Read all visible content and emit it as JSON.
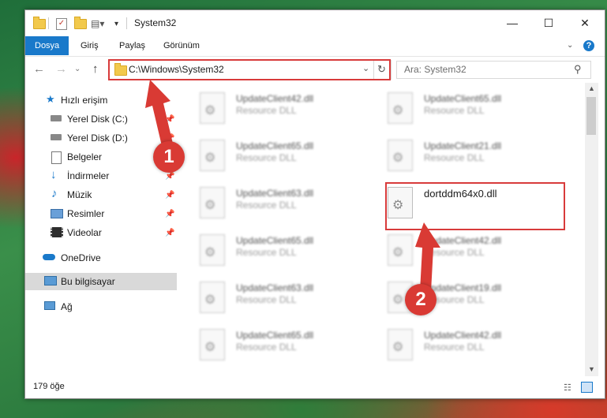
{
  "window": {
    "title": "System32",
    "controls": {
      "minimize": "—",
      "maximize": "☐",
      "close": "✕"
    }
  },
  "ribbon": {
    "tabs": [
      "Dosya",
      "Giriş",
      "Paylaş",
      "Görünüm"
    ],
    "active_tab": "Dosya",
    "help": "?"
  },
  "address": {
    "path": "C:\\Windows\\System32",
    "search_placeholder": "Ara: System32"
  },
  "nav": {
    "items": [
      {
        "label": "Hızlı erişim",
        "icon": "star-icon",
        "pinned": false
      },
      {
        "label": "Yerel Disk (C:)",
        "icon": "drive-icon",
        "pinned": true
      },
      {
        "label": "Yerel Disk (D:)",
        "icon": "drive-icon",
        "pinned": true
      },
      {
        "label": "Belgeler",
        "icon": "documents-icon",
        "pinned": true
      },
      {
        "label": "İndirmeler",
        "icon": "download-icon",
        "pinned": true
      },
      {
        "label": "Müzik",
        "icon": "music-icon",
        "pinned": true
      },
      {
        "label": "Resimler",
        "icon": "pictures-icon",
        "pinned": true
      },
      {
        "label": "Videolar",
        "icon": "videos-icon",
        "pinned": true
      },
      {
        "label": "OneDrive",
        "icon": "cloud-icon",
        "pinned": false
      },
      {
        "label": "Bu bilgisayar",
        "icon": "computer-icon",
        "pinned": false,
        "selected": true
      },
      {
        "label": "Ağ",
        "icon": "network-icon",
        "pinned": false
      }
    ]
  },
  "files": {
    "left": [
      {
        "name": "UpdateClient42.dll",
        "type": "Resource DLL"
      },
      {
        "name": "UpdateClient65.dll",
        "type": "Resource DLL"
      },
      {
        "name": "UpdateClient63.dll",
        "type": "Resource DLL"
      },
      {
        "name": "UpdateClient65.dll",
        "type": "Resource DLL"
      },
      {
        "name": "UpdateClient63.dll",
        "type": "Resource DLL"
      },
      {
        "name": "UpdateClient65.dll",
        "type": "Resource DLL"
      }
    ],
    "right": [
      {
        "name": "UpdateClient65.dll",
        "type": "Resource DLL"
      },
      {
        "name": "UpdateClient21.dll",
        "type": "Resource DLL"
      },
      {
        "name": "dortddm64x0.dll",
        "type": ""
      },
      {
        "name": "UpdateClient42.dll",
        "type": "Resource DLL"
      },
      {
        "name": "UpdateClient19.dll",
        "type": "Resource DLL"
      },
      {
        "name": "UpdateClient42.dll",
        "type": "Resource DLL"
      }
    ]
  },
  "status": {
    "count": "179 öğe"
  },
  "annotations": {
    "step1": "1",
    "step2": "2",
    "color": "#d83b3b"
  }
}
